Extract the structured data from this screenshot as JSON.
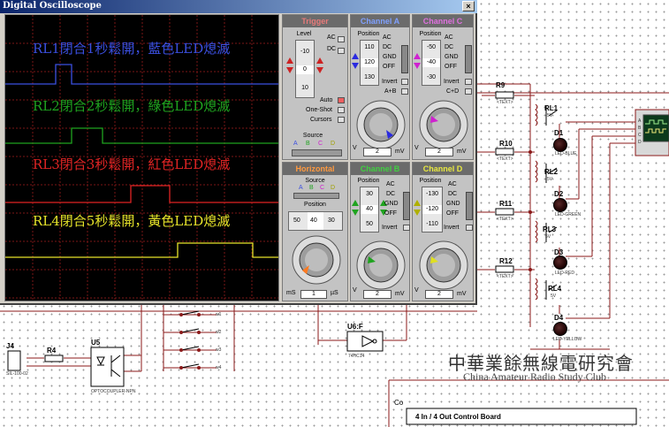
{
  "window": {
    "title": "Digital Oscilloscope",
    "close_glyph": "×"
  },
  "screen": {
    "traces": [
      {
        "label": "RL1閉合1秒鬆開，藍色LED熄滅",
        "color": "#3b4fe0"
      },
      {
        "label": "RL2閉合2秒鬆開，綠色LED熄滅",
        "color": "#1fa31f"
      },
      {
        "label": "RL3閉合3秒鬆開，紅色LED熄滅",
        "color": "#e02424"
      },
      {
        "label": "RL4閉合5秒鬆開，黃色LED熄滅",
        "color": "#e6e32a"
      }
    ]
  },
  "trigger": {
    "title": "Trigger",
    "level_label": "Level",
    "level_values": [
      "-10",
      "0",
      "10"
    ],
    "coupling": [
      "AC",
      "DC"
    ],
    "modes": [
      "Auto",
      "One-Shot",
      "Cursors"
    ],
    "source_label": "Source",
    "sources": [
      "A",
      "B",
      "C",
      "D"
    ]
  },
  "channel_a": {
    "title": "Channel A",
    "position_label": "Position",
    "position_values": [
      "110",
      "120",
      "130"
    ],
    "coupling": [
      "AC",
      "DC",
      "GND",
      "OFF"
    ],
    "invert": "Invert",
    "combine": "A+B",
    "scale_value": "2",
    "scale_unit": "mV",
    "scale_left": "V"
  },
  "channel_c": {
    "title": "Channel C",
    "position_label": "Position",
    "position_values": [
      "-50",
      "-40",
      "-30"
    ],
    "coupling": [
      "AC",
      "DC",
      "GND",
      "OFF"
    ],
    "invert": "Invert",
    "combine": "C+D",
    "scale_value": "2",
    "scale_unit": "mV",
    "scale_left": "V"
  },
  "horizontal": {
    "title": "Horizontal",
    "source_label": "Source",
    "sources": [
      "A",
      "B",
      "C",
      "D"
    ],
    "position_label": "Position",
    "position_values": [
      "50",
      "40",
      "30"
    ],
    "scale_value": "1",
    "unit_left": "mS",
    "unit_right": "µS"
  },
  "channel_b": {
    "title": "Channel B",
    "position_label": "Position",
    "position_values": [
      "30",
      "40",
      "50"
    ],
    "coupling": [
      "AC",
      "DC",
      "GND",
      "OFF"
    ],
    "invert": "Invert",
    "scale_value": "2",
    "scale_unit": "mV",
    "scale_left": "V"
  },
  "channel_d": {
    "title": "Channel D",
    "position_label": "Position",
    "position_values": [
      "-130",
      "-120",
      "-110"
    ],
    "coupling": [
      "AC",
      "DC",
      "GND",
      "OFF"
    ],
    "invert": "Invert",
    "scale_value": "2",
    "scale_unit": "mV",
    "scale_left": "V"
  },
  "schematic": {
    "resistors": [
      "R9",
      "R10",
      "R11",
      "R12",
      "R4"
    ],
    "relays": [
      "RL1",
      "RL2",
      "RL3",
      "RL4"
    ],
    "relay_voltage": "5V",
    "leds": [
      {
        "ref": "D1",
        "part": "LED-BLUE"
      },
      {
        "ref": "D2",
        "part": "LED-GREEN"
      },
      {
        "ref": "D3",
        "part": "LED-RED"
      },
      {
        "ref": "D4",
        "part": "LED-YELLOW"
      }
    ],
    "connector": "J4",
    "connector_part": "SIL-100-02",
    "optocoupler": "U5",
    "optocoupler_part": "OPTOCOUPLER-NPN",
    "gate": "U6:F",
    "gate_part": "74HC14",
    "text_placeholder": "<TEXT>",
    "switch_labels": [
      "w1",
      "w2",
      "w3",
      "w4"
    ],
    "co_label": "Co",
    "board_title": "4 In / 4 Out Control Board",
    "scope_pins": [
      "A",
      "B",
      "C",
      "D"
    ]
  },
  "watermark": {
    "chinese": "中華業餘無線電研究會",
    "english": "China Amateur Radio Study Club"
  }
}
